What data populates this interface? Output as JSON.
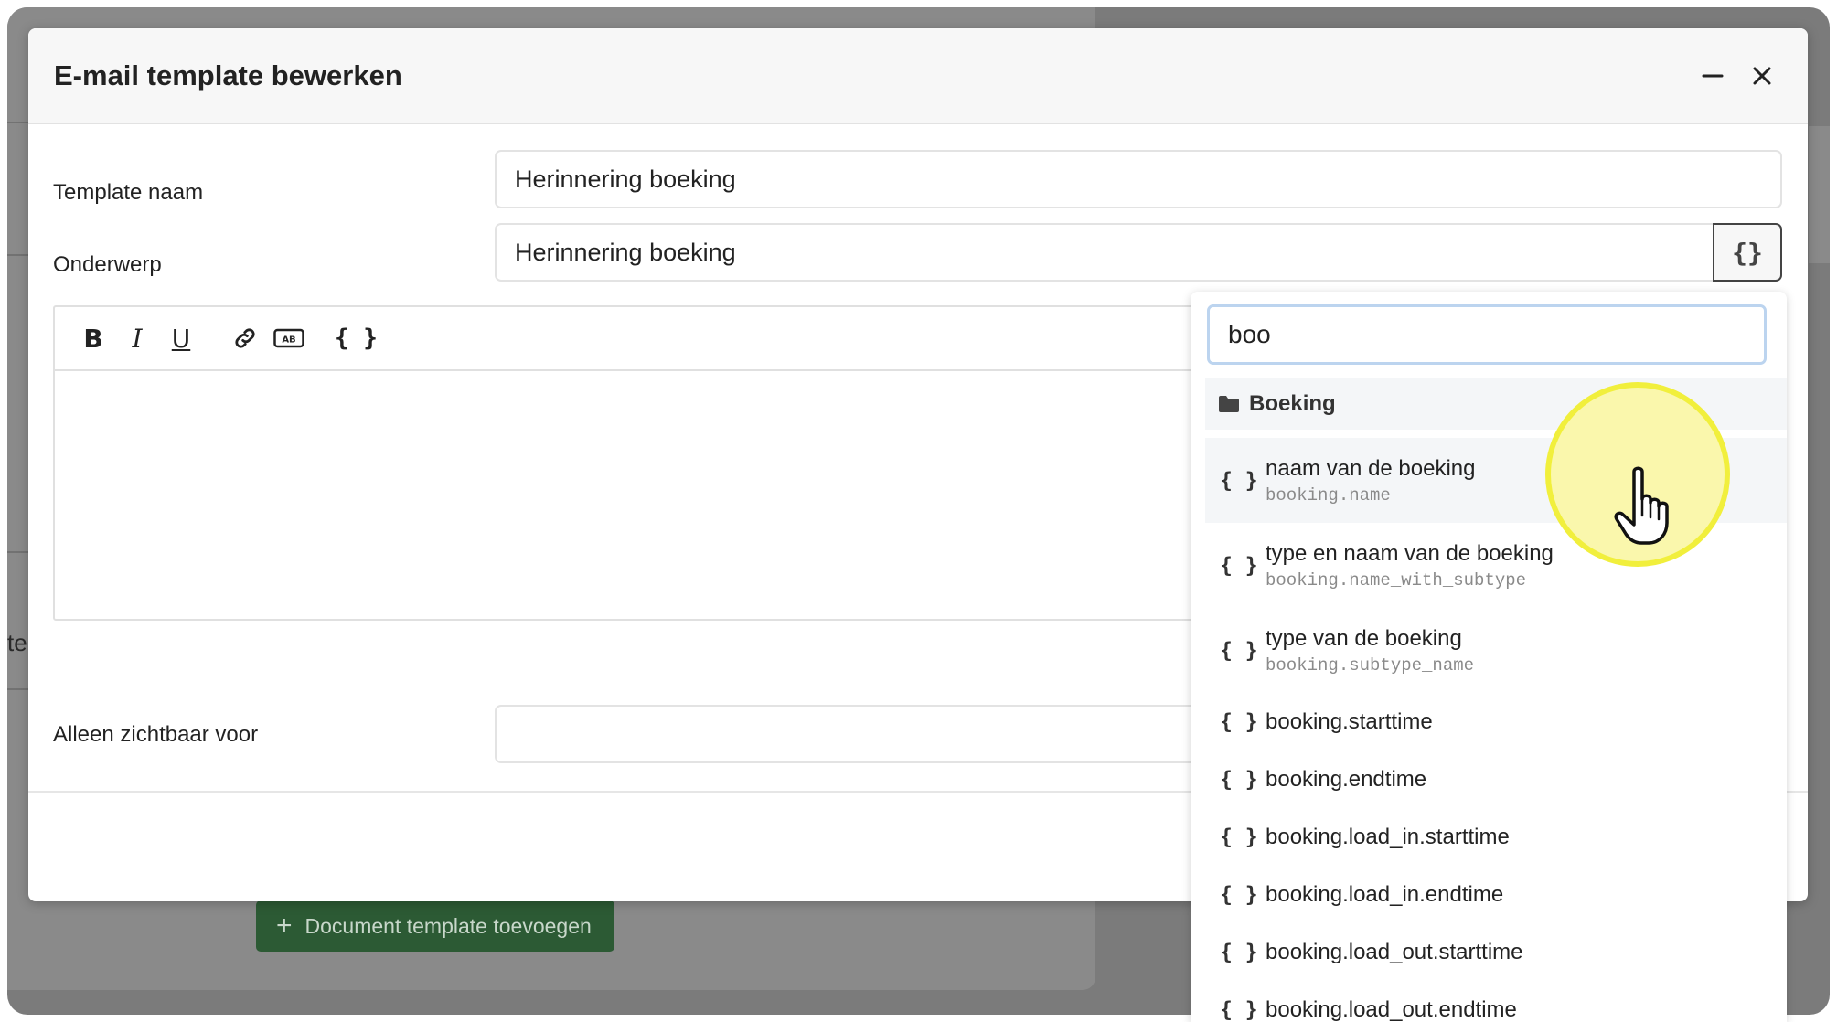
{
  "background": {
    "left_partial_text": "te:",
    "document_button_label": "Document template toevoegen"
  },
  "modal": {
    "title": "E-mail template bewerken",
    "minimize_icon": "minus-icon",
    "close_icon": "close-icon"
  },
  "form": {
    "template_name_label": "Template naam",
    "template_name_value": "Herinnering boeking",
    "subject_label": "Onderwerp",
    "subject_value": "Herinnering boeking",
    "variable_button_glyph": "{}",
    "visible_for_label": "Alleen zichtbaar voor",
    "visible_for_value": ""
  },
  "editor": {
    "toolbar": {
      "bold": "B",
      "italic": "I",
      "underline": "U",
      "link_icon": "link-icon",
      "abbr_icon": "text-box-icon",
      "variable": "{ }"
    }
  },
  "dropdown": {
    "search_value": "boo",
    "group_icon": "folder-icon",
    "group_label": "Boeking",
    "brace_glyph": "{ }",
    "items": [
      {
        "label": "naam van de boeking",
        "code": "booking.name",
        "highlighted": true
      },
      {
        "label": "type en naam van de boeking",
        "code": "booking.name_with_subtype"
      },
      {
        "label": "type van de boeking",
        "code": "booking.subtype_name"
      },
      {
        "label": "booking.starttime"
      },
      {
        "label": "booking.endtime"
      },
      {
        "label": "booking.load_in.starttime"
      },
      {
        "label": "booking.load_in.endtime"
      },
      {
        "label": "booking.load_out.starttime"
      },
      {
        "label": "booking.load_out.endtime"
      }
    ]
  },
  "colors": {
    "cursor_highlight": "#f1ef3c",
    "document_button": "#2c5a34",
    "search_focus_border": "#bcd4ef"
  }
}
